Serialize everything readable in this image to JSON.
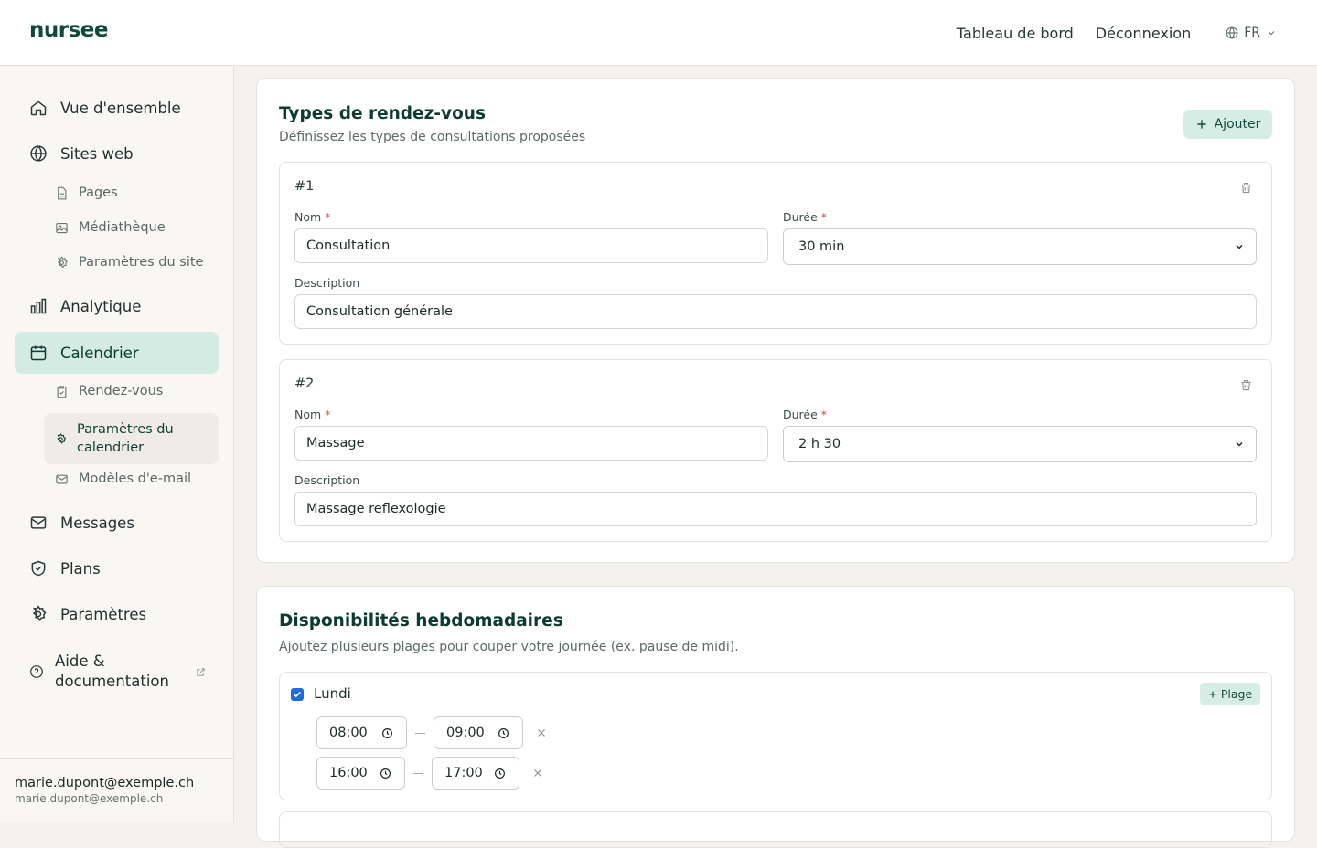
{
  "header": {
    "logo": "nursee",
    "links": [
      "Tableau de bord",
      "Déconnexion"
    ],
    "lang": "FR",
    "icons": [
      "globe-icon",
      "chevron-down-icon"
    ]
  },
  "sidebar": {
    "items": [
      {
        "label": "Vue d'ensemble",
        "icon": "home-icon"
      },
      {
        "label": "Sites web",
        "icon": "globe-icon"
      },
      {
        "label": "Pages",
        "icon": "file-icon"
      },
      {
        "label": "Médiathèque",
        "icon": "image-icon"
      },
      {
        "label": "Paramètres du site",
        "icon": "gear-icon"
      },
      {
        "label": "Analytique",
        "icon": "bar-chart-icon"
      },
      {
        "label": "Calendrier",
        "icon": "calendar-icon"
      },
      {
        "label": "Rendez-vous",
        "icon": "clipboard-icon"
      },
      {
        "label": "Paramètres du calendrier",
        "icon": "gear-icon"
      },
      {
        "label": "Modèles d'e-mail",
        "icon": "mail-icon"
      },
      {
        "label": "Messages",
        "icon": "mail-icon"
      },
      {
        "label": "Plans",
        "icon": "shield-icon"
      },
      {
        "label": "Paramètres",
        "icon": "gear-icon"
      },
      {
        "label": "Aide & documentation",
        "icon": "help-circle-icon"
      }
    ],
    "active": "Calendrier",
    "active_sub": "Paramètres du calendrier",
    "user": {
      "name": "marie.dupont@exemple.ch",
      "email": "marie.dupont@exemple.ch"
    }
  },
  "types": {
    "title": "Types de rendez-vous",
    "subtitle": "Définissez les types de consultations proposées",
    "add_label": "Ajouter",
    "name_label": "Nom",
    "duration_label": "Durée",
    "required_mark": "*",
    "description_label": "Description",
    "items": [
      {
        "num": "#1",
        "name": "Consultation",
        "duration": "30 min",
        "description": "Consultation générale"
      },
      {
        "num": "#2",
        "name": "Massage",
        "duration": "2 h 30",
        "description": "Massage reflexologie"
      }
    ]
  },
  "availability": {
    "title": "Disponibilités hebdomadaires",
    "subtitle": "Ajoutez plusieurs plages pour couper votre journée (ex. pause de midi).",
    "plage_label": "Plage",
    "days": [
      {
        "name": "Lundi",
        "checked": true,
        "ranges": [
          {
            "start": "08:00",
            "end": "09:00"
          },
          {
            "start": "16:00",
            "end": "17:00"
          }
        ]
      }
    ]
  },
  "colors": {
    "accent": "#0e4a3a",
    "accent_light": "#d3ebe3",
    "required": "#d64545",
    "checkbox": "#1e6ddb"
  }
}
